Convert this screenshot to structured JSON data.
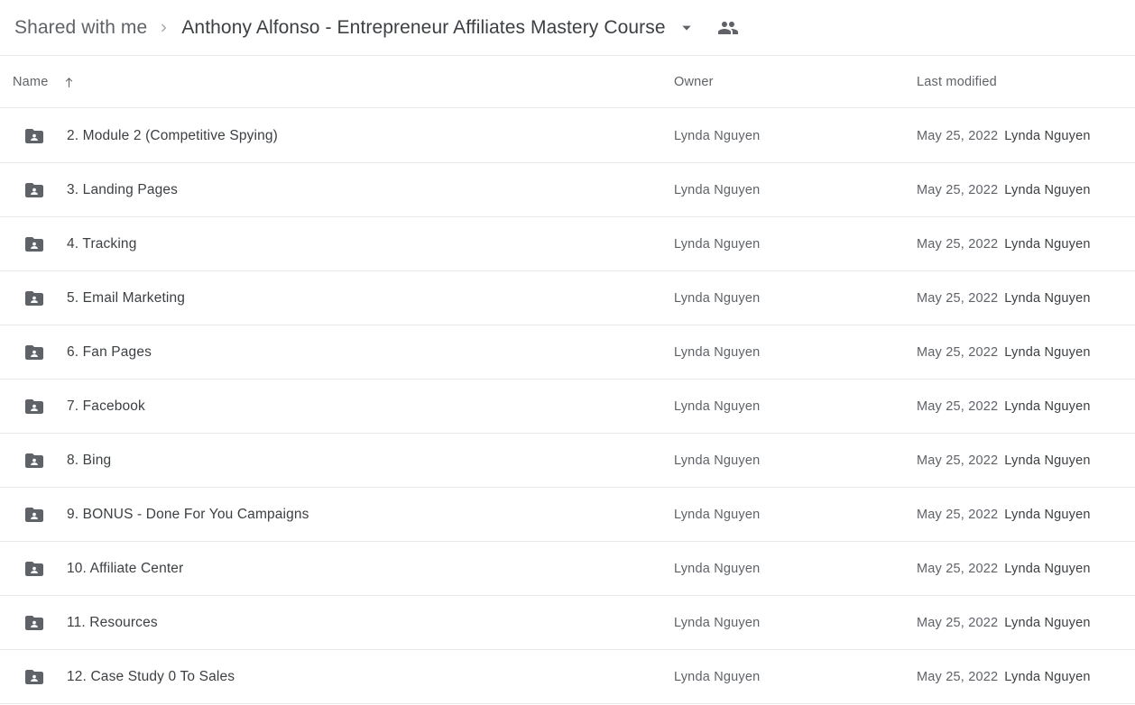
{
  "breadcrumb": {
    "parent_label": "Shared with me",
    "separator_icon": "chevron-right-icon",
    "current_label": "Anthony Alfonso - Entrepreneur Affiliates Mastery Course",
    "caret_icon": "chevron-down-icon",
    "shared_icon": "people-icon"
  },
  "columns": {
    "name": "Name",
    "sort_icon": "arrow-up-icon",
    "owner": "Owner",
    "last_modified": "Last modified"
  },
  "colors": {
    "folder_icon": "#5f6368",
    "primary_text": "#3c4043",
    "secondary_text": "#5f6368",
    "divider": "#e8eaed"
  },
  "files": [
    {
      "icon": "shared-folder-icon",
      "name": "2. Module 2 (Competitive Spying)",
      "owner": "Lynda Nguyen",
      "modified_date": "May 25, 2022",
      "modified_by": "Lynda Nguyen"
    },
    {
      "icon": "shared-folder-icon",
      "name": "3. Landing Pages",
      "owner": "Lynda Nguyen",
      "modified_date": "May 25, 2022",
      "modified_by": "Lynda Nguyen"
    },
    {
      "icon": "shared-folder-icon",
      "name": "4. Tracking",
      "owner": "Lynda Nguyen",
      "modified_date": "May 25, 2022",
      "modified_by": "Lynda Nguyen"
    },
    {
      "icon": "shared-folder-icon",
      "name": "5. Email Marketing",
      "owner": "Lynda Nguyen",
      "modified_date": "May 25, 2022",
      "modified_by": "Lynda Nguyen"
    },
    {
      "icon": "shared-folder-icon",
      "name": "6. Fan Pages",
      "owner": "Lynda Nguyen",
      "modified_date": "May 25, 2022",
      "modified_by": "Lynda Nguyen"
    },
    {
      "icon": "shared-folder-icon",
      "name": "7. Facebook",
      "owner": "Lynda Nguyen",
      "modified_date": "May 25, 2022",
      "modified_by": "Lynda Nguyen"
    },
    {
      "icon": "shared-folder-icon",
      "name": "8. Bing",
      "owner": "Lynda Nguyen",
      "modified_date": "May 25, 2022",
      "modified_by": "Lynda Nguyen"
    },
    {
      "icon": "shared-folder-icon",
      "name": "9. BONUS - Done For You Campaigns",
      "owner": "Lynda Nguyen",
      "modified_date": "May 25, 2022",
      "modified_by": "Lynda Nguyen"
    },
    {
      "icon": "shared-folder-icon",
      "name": "10. Affiliate Center",
      "owner": "Lynda Nguyen",
      "modified_date": "May 25, 2022",
      "modified_by": "Lynda Nguyen"
    },
    {
      "icon": "shared-folder-icon",
      "name": "11. Resources",
      "owner": "Lynda Nguyen",
      "modified_date": "May 25, 2022",
      "modified_by": "Lynda Nguyen"
    },
    {
      "icon": "shared-folder-icon",
      "name": "12. Case Study 0 To Sales",
      "owner": "Lynda Nguyen",
      "modified_date": "May 25, 2022",
      "modified_by": "Lynda Nguyen"
    }
  ]
}
